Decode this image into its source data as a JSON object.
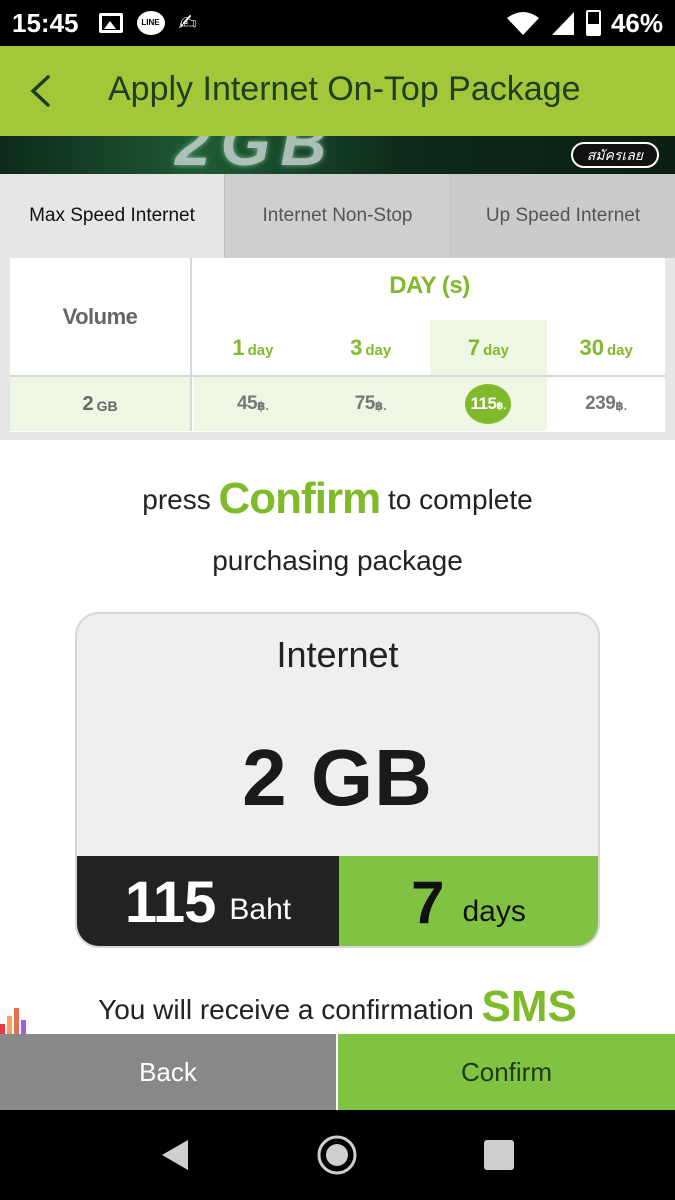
{
  "status_bar": {
    "time": "15:45",
    "battery": "46%",
    "icons": [
      "image-icon",
      "line-app-icon",
      "pen-icon",
      "wifi-icon",
      "signal-icon",
      "battery-icon"
    ]
  },
  "header": {
    "title": "Apply Internet On-Top Package",
    "back_icon": "chevron-left-icon",
    "bg_color": "#a4c639"
  },
  "banner": {
    "big_text": "2GB",
    "button_label": "สมัครเลย"
  },
  "tabs": [
    {
      "label": "Max Speed Internet",
      "active": true
    },
    {
      "label": "Internet Non-Stop",
      "active": false
    },
    {
      "label": "Up Speed Internet",
      "active": false
    }
  ],
  "price_table": {
    "volume_header": "Volume",
    "days_header": "DAY (s)",
    "day_unit": "day",
    "days": [
      "1",
      "3",
      "7",
      "30"
    ],
    "selected_day_index": 2,
    "row": {
      "volume": "2",
      "volume_unit": "GB",
      "prices": [
        "45",
        "75",
        "115",
        "239"
      ],
      "price_unit": "฿."
    }
  },
  "confirm_text": {
    "before": "press",
    "highlight": "Confirm",
    "after": "to complete",
    "line2": "purchasing package"
  },
  "package_card": {
    "title": "Internet",
    "volume": "2 GB",
    "price": "115",
    "price_unit": "Baht",
    "days": "7",
    "days_unit": "days"
  },
  "sms_text": {
    "before": "You will receive a confirmation",
    "highlight": "SMS"
  },
  "buttons": {
    "back": "Back",
    "confirm": "Confirm"
  },
  "colors": {
    "accent_green": "#7fba2a",
    "button_green": "#80c241",
    "dark": "#222222",
    "gray_button": "#888888"
  },
  "nav_bar": {
    "icons": [
      "nav-back-icon",
      "nav-home-icon",
      "nav-recents-icon"
    ]
  }
}
